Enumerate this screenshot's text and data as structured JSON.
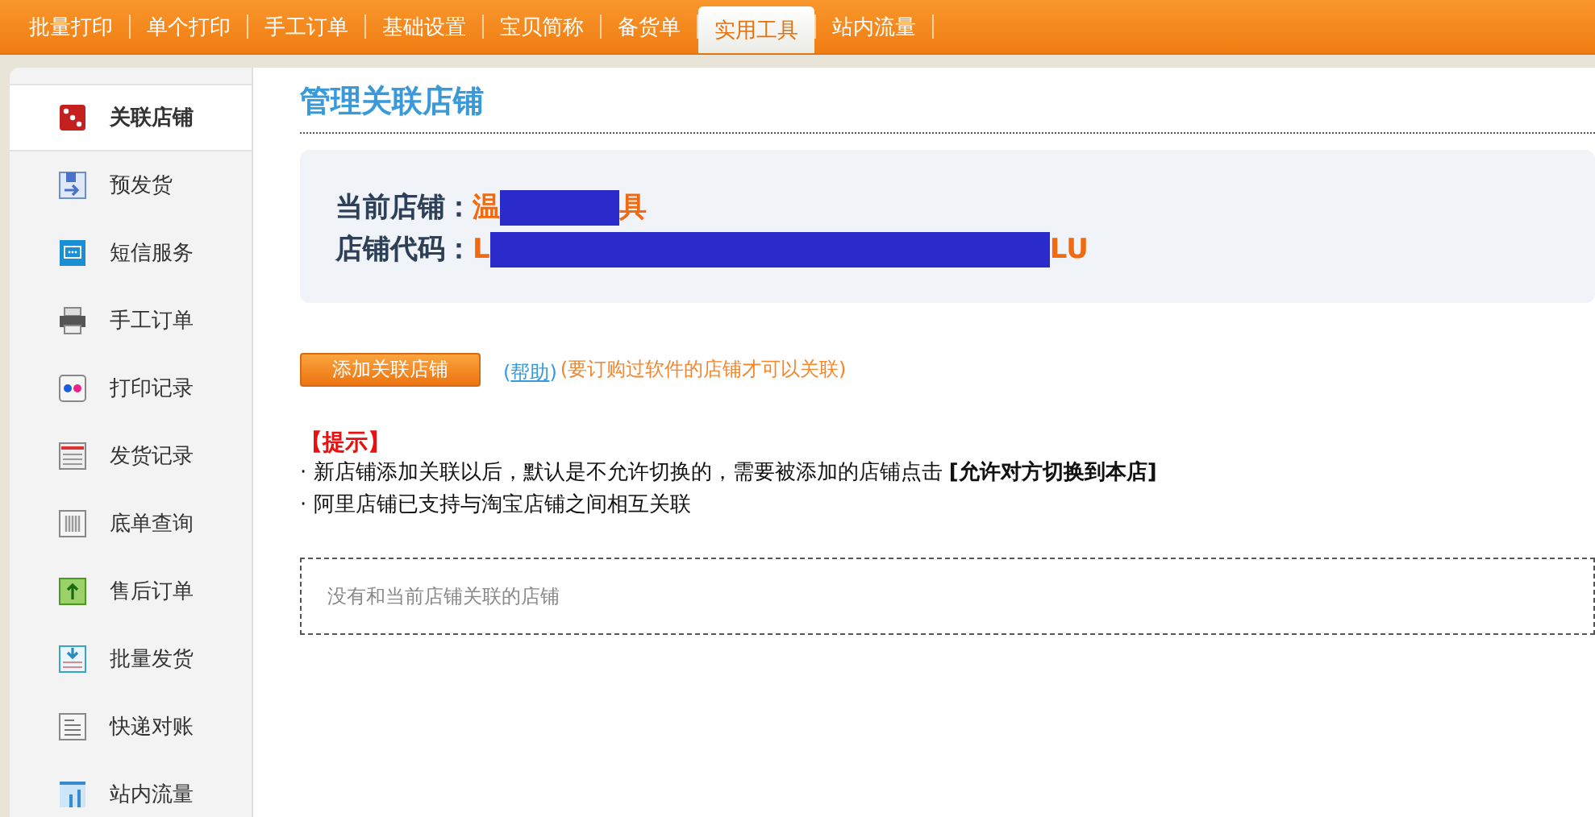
{
  "nav": [
    {
      "label": "批量打印",
      "selected": false
    },
    {
      "label": "单个打印",
      "selected": false
    },
    {
      "label": "手工订单",
      "selected": false
    },
    {
      "label": "基础设置",
      "selected": false
    },
    {
      "label": "宝贝简称",
      "selected": false
    },
    {
      "label": "备货单",
      "selected": false
    },
    {
      "label": "实用工具",
      "selected": true
    },
    {
      "label": "站内流量",
      "selected": false
    }
  ],
  "sidebar": {
    "items": [
      {
        "label": "关联店铺",
        "selected": true
      },
      {
        "label": "预发货",
        "selected": false
      },
      {
        "label": "短信服务",
        "selected": false
      },
      {
        "label": "手工订单",
        "selected": false
      },
      {
        "label": "打印记录",
        "selected": false
      },
      {
        "label": "发货记录",
        "selected": false
      },
      {
        "label": "底单查询",
        "selected": false
      },
      {
        "label": "售后订单",
        "selected": false
      },
      {
        "label": "批量发货",
        "selected": false
      },
      {
        "label": "快递对账",
        "selected": false
      },
      {
        "label": "站内流量",
        "selected": false
      }
    ]
  },
  "title": "管理关联店铺",
  "shop_info": [
    {
      "label": "当前店铺：",
      "value_start": "温",
      "value_end": "具"
    },
    {
      "label": "店铺代码：",
      "value_start": "L",
      "value_end": "LU"
    }
  ],
  "add_button": "添加关联店铺",
  "help_open": "(",
  "help_link": "帮助",
  "help_close": ")",
  "help_note": "(要订购过软件的店铺才可以关联)",
  "tips": {
    "heading": "【提示】",
    "lines": [
      "· 新店铺添加关联以后，默认是不允许切换的，需要被添加的店铺点击 **[允许对方切换到本店]**",
      "· 阿里店铺已支持与淘宝店铺之间相互关联"
    ]
  },
  "linked_shops": {
    "empty_message": "没有和当前店铺关联的店铺"
  }
}
